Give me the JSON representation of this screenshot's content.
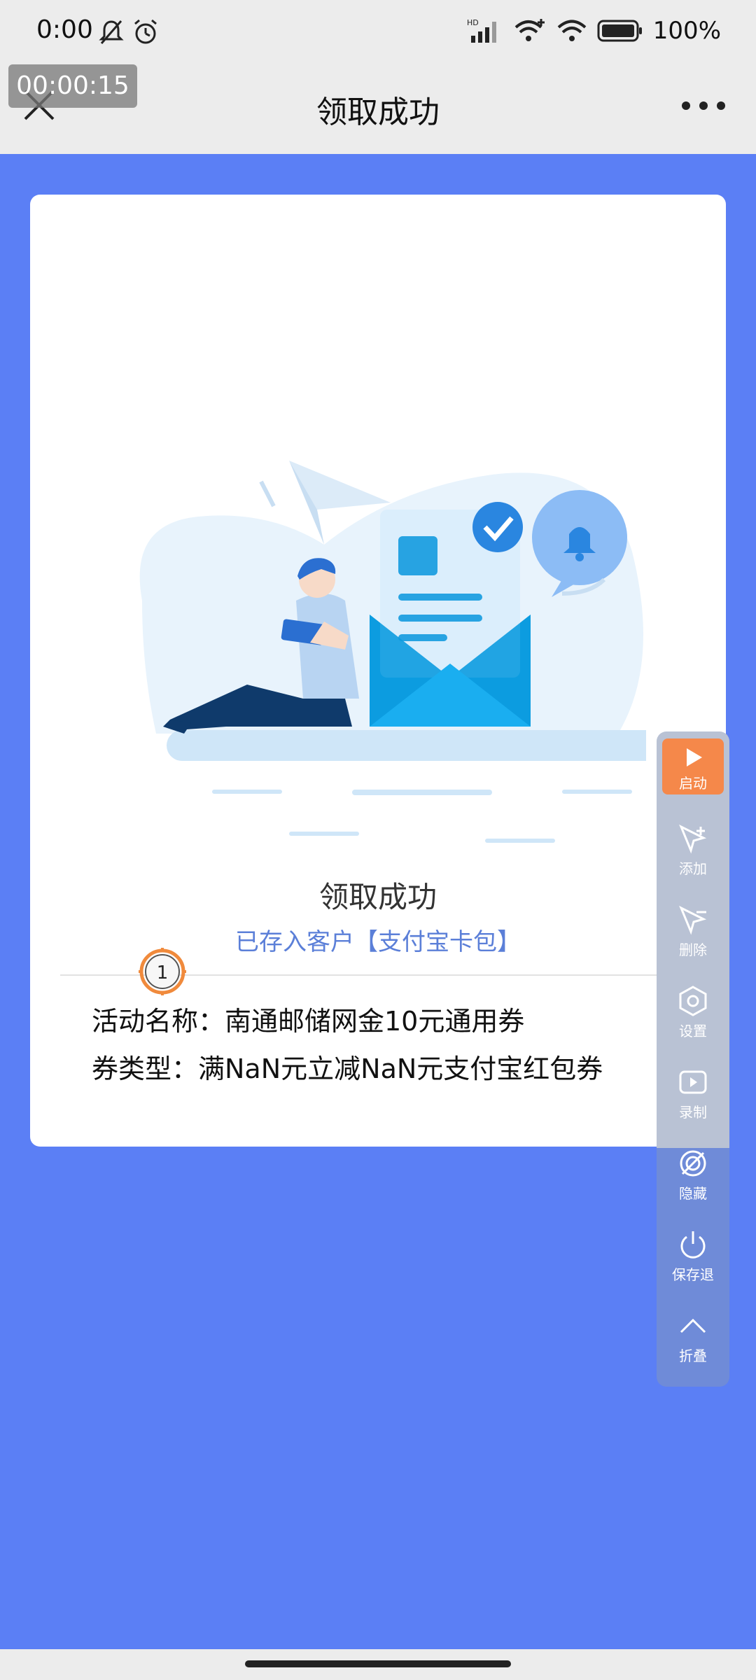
{
  "status_bar": {
    "time": "0:00",
    "battery": "100%",
    "icons": [
      "mute-bell-icon",
      "alarm-icon",
      "hd-signal-icon",
      "wifi-plus-icon",
      "wifi-icon",
      "battery-icon"
    ]
  },
  "timer": "00:00:15",
  "navbar": {
    "title": "领取成功",
    "close_icon": "close-icon",
    "more_icon": "more-icon"
  },
  "card": {
    "title": "领取成功",
    "subtitle": "已存入客户【支付宝卡包】",
    "activity_line": "活动名称：南通邮储网金10元通用券",
    "coupon_line": "券类型：满NaN元立减NaN元支付宝红包券"
  },
  "marker": {
    "number": "1"
  },
  "float_toolbar": {
    "items": [
      {
        "label": "启动",
        "icon": "play-icon"
      },
      {
        "label": "添加",
        "icon": "cursor-plus-icon"
      },
      {
        "label": "删除",
        "icon": "cursor-minus-icon"
      },
      {
        "label": "设置",
        "icon": "gear-icon"
      },
      {
        "label": "录制",
        "icon": "record-icon"
      },
      {
        "label": "隐藏",
        "icon": "hide-icon"
      },
      {
        "label": "保存退",
        "icon": "power-icon"
      },
      {
        "label": "折叠",
        "icon": "chevron-up-icon"
      }
    ]
  },
  "colors": {
    "background": "#5b7ff5",
    "accent_text": "#5b7fd8",
    "start_button": "#f5884a"
  }
}
